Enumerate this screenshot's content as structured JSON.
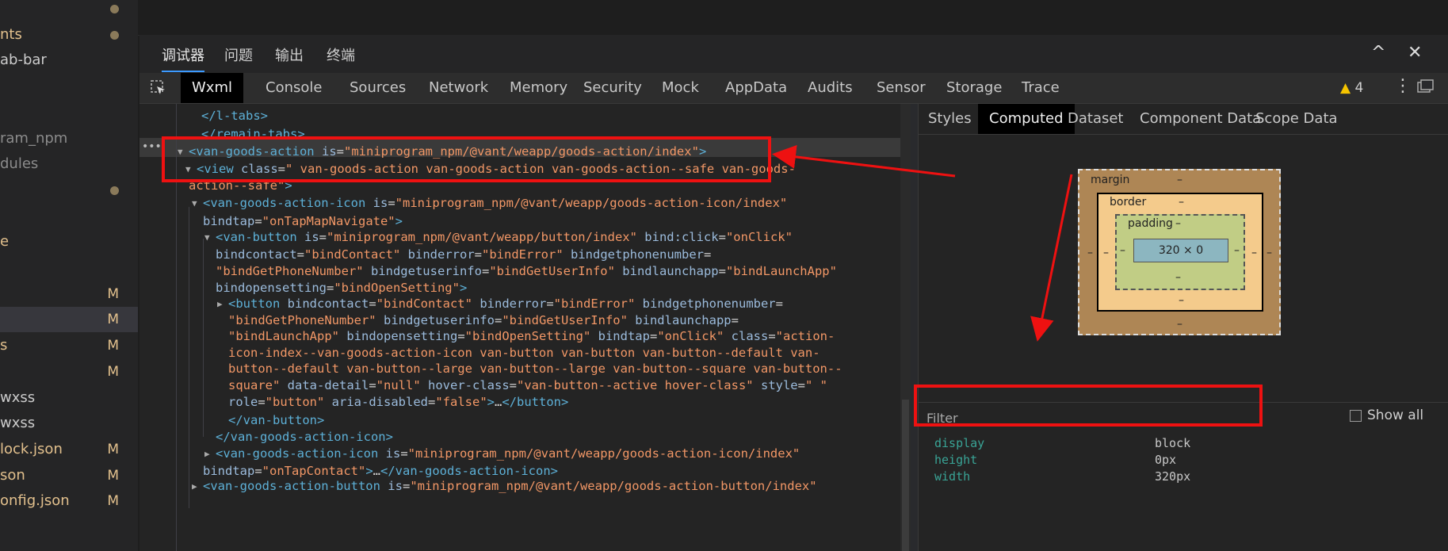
{
  "explorer": {
    "items": [
      {
        "label": "",
        "mark": "dot",
        "color": "g"
      },
      {
        "label": "nts",
        "mark": "dot",
        "color": "y"
      },
      {
        "label": "ab-bar",
        "mark": "",
        "color": "g"
      },
      {
        "label": "",
        "mark": "",
        "color": "g"
      },
      {
        "label": "",
        "mark": "",
        "color": "g"
      },
      {
        "label": "ram_npm",
        "mark": "",
        "color": "d"
      },
      {
        "label": "dules",
        "mark": "",
        "color": "d"
      },
      {
        "label": "",
        "mark": "dot",
        "color": "g"
      },
      {
        "label": "",
        "mark": "",
        "color": "g"
      },
      {
        "label": "e",
        "mark": "",
        "color": "y"
      },
      {
        "label": "",
        "mark": "",
        "color": "g"
      },
      {
        "label": "",
        "mark": "M",
        "color": "y"
      },
      {
        "label": "",
        "mark": "M",
        "color": "y"
      },
      {
        "label": "s",
        "mark": "M",
        "color": "y"
      },
      {
        "label": "",
        "mark": "M",
        "color": "y"
      },
      {
        "label": "wxss",
        "mark": "",
        "color": "g"
      },
      {
        "label": "wxss",
        "mark": "",
        "color": "g"
      },
      {
        "label": "lock.json",
        "mark": "M",
        "color": "y"
      },
      {
        "label": "son",
        "mark": "M",
        "color": "y"
      },
      {
        "label": "onfig.json",
        "mark": "M",
        "color": "y"
      }
    ]
  },
  "panel_tabs": [
    "调试器",
    "问题",
    "输出",
    "终端"
  ],
  "window_controls": {
    "collapse": "^",
    "close": "✕"
  },
  "tool_tabs": [
    "Wxml",
    "Console",
    "Sources",
    "Network",
    "Memory",
    "Security",
    "Mock",
    "AppData",
    "Audits",
    "Sensor",
    "Storage",
    "Trace"
  ],
  "warnings": {
    "count": "4",
    "icon": "warning-triangle-icon"
  },
  "tree": {
    "lines": [
      [
        [
          "tg",
          "</l-tabs>"
        ]
      ],
      [
        [
          "tg",
          "</remain-tabs>"
        ]
      ],
      [
        [
          "tg",
          "<van-goods-action "
        ],
        [
          "an",
          "is"
        ],
        [
          "tx",
          "="
        ],
        [
          "av",
          "\"miniprogram_npm/@vant/weapp/goods-action/index\""
        ],
        [
          "tg",
          ">"
        ]
      ],
      [
        [
          "tg",
          "<view "
        ],
        [
          "an",
          "class"
        ],
        [
          "tx",
          "="
        ],
        [
          "av",
          "\" van-goods-action van-goods-action van-goods-action--safe van-goods-"
        ]
      ],
      [
        [
          "av",
          "action--safe\""
        ],
        [
          "tg",
          ">"
        ]
      ],
      [
        [
          "tg",
          "<van-goods-action-icon "
        ],
        [
          "an",
          "is"
        ],
        [
          "tx",
          "="
        ],
        [
          "av",
          "\"miniprogram_npm/@vant/weapp/goods-action-icon/index\""
        ]
      ],
      [
        [
          "an",
          "bindtap"
        ],
        [
          "tx",
          "="
        ],
        [
          "av",
          "\"onTapMapNavigate\""
        ],
        [
          "tg",
          ">"
        ]
      ],
      [
        [
          "tg",
          "<van-button "
        ],
        [
          "an",
          "is"
        ],
        [
          "tx",
          "="
        ],
        [
          "av",
          "\"miniprogram_npm/@vant/weapp/button/index\""
        ],
        [
          "tx",
          " "
        ],
        [
          "an",
          "bind:click"
        ],
        [
          "tx",
          "="
        ],
        [
          "av",
          "\"onClick\""
        ]
      ],
      [
        [
          "an",
          "bindcontact"
        ],
        [
          "tx",
          "="
        ],
        [
          "av",
          "\"bindContact\""
        ],
        [
          "tx",
          " "
        ],
        [
          "an",
          "binderror"
        ],
        [
          "tx",
          "="
        ],
        [
          "av",
          "\"bindError\""
        ],
        [
          "tx",
          " "
        ],
        [
          "an",
          "bindgetphonenumber"
        ],
        [
          "tx",
          "="
        ]
      ],
      [
        [
          "av",
          "\"bindGetPhoneNumber\""
        ],
        [
          "tx",
          " "
        ],
        [
          "an",
          "bindgetuserinfo"
        ],
        [
          "tx",
          "="
        ],
        [
          "av",
          "\"bindGetUserInfo\""
        ],
        [
          "tx",
          " "
        ],
        [
          "an",
          "bindlaunchapp"
        ],
        [
          "tx",
          "="
        ],
        [
          "av",
          "\"bindLaunchApp\""
        ]
      ],
      [
        [
          "an",
          "bindopensetting"
        ],
        [
          "tx",
          "="
        ],
        [
          "av",
          "\"bindOpenSetting\""
        ],
        [
          "tg",
          ">"
        ]
      ],
      [
        [
          "tg",
          "<button "
        ],
        [
          "an",
          "bindcontact"
        ],
        [
          "tx",
          "="
        ],
        [
          "av",
          "\"bindContact\""
        ],
        [
          "tx",
          " "
        ],
        [
          "an",
          "binderror"
        ],
        [
          "tx",
          "="
        ],
        [
          "av",
          "\"bindError\""
        ],
        [
          "tx",
          " "
        ],
        [
          "an",
          "bindgetphonenumber"
        ],
        [
          "tx",
          "="
        ]
      ],
      [
        [
          "av",
          "\"bindGetPhoneNumber\""
        ],
        [
          "tx",
          " "
        ],
        [
          "an",
          "bindgetuserinfo"
        ],
        [
          "tx",
          "="
        ],
        [
          "av",
          "\"bindGetUserInfo\""
        ],
        [
          "tx",
          " "
        ],
        [
          "an",
          "bindlaunchapp"
        ],
        [
          "tx",
          "="
        ]
      ],
      [
        [
          "av",
          "\"bindLaunchApp\""
        ],
        [
          "tx",
          " "
        ],
        [
          "an",
          "bindopensetting"
        ],
        [
          "tx",
          "="
        ],
        [
          "av",
          "\"bindOpenSetting\""
        ],
        [
          "tx",
          " "
        ],
        [
          "an",
          "bindtap"
        ],
        [
          "tx",
          "="
        ],
        [
          "av",
          "\"onClick\""
        ],
        [
          "tx",
          " "
        ],
        [
          "an",
          "class"
        ],
        [
          "tx",
          "="
        ],
        [
          "av",
          "\"action-"
        ]
      ],
      [
        [
          "av",
          "icon-index--van-goods-action-icon van-button van-button van-button--default van-"
        ]
      ],
      [
        [
          "av",
          "button--default van-button--large van-button--large van-button--square van-button--"
        ]
      ],
      [
        [
          "av",
          "square\""
        ],
        [
          "tx",
          " "
        ],
        [
          "an",
          "data-detail"
        ],
        [
          "tx",
          "="
        ],
        [
          "av",
          "\"null\""
        ],
        [
          "tx",
          " "
        ],
        [
          "an",
          "hover-class"
        ],
        [
          "tx",
          "="
        ],
        [
          "av",
          "\"van-button--active hover-class\""
        ],
        [
          "tx",
          " "
        ],
        [
          "an",
          "style"
        ],
        [
          "tx",
          "="
        ],
        [
          "av",
          "\" \""
        ]
      ],
      [
        [
          "an",
          "role"
        ],
        [
          "tx",
          "="
        ],
        [
          "av",
          "\"button\""
        ],
        [
          "tx",
          " "
        ],
        [
          "an",
          "aria-disabled"
        ],
        [
          "tx",
          "="
        ],
        [
          "av",
          "\"false\""
        ],
        [
          "tg",
          ">"
        ],
        [
          "tx",
          "…"
        ],
        [
          "tg",
          "</button>"
        ]
      ],
      [
        [
          "tg",
          "</van-button>"
        ]
      ],
      [
        [
          "tg",
          "</van-goods-action-icon>"
        ]
      ],
      [
        [
          "tg",
          "<van-goods-action-icon "
        ],
        [
          "an",
          "is"
        ],
        [
          "tx",
          "="
        ],
        [
          "av",
          "\"miniprogram_npm/@vant/weapp/goods-action-icon/index\""
        ]
      ],
      [
        [
          "an",
          "bindtap"
        ],
        [
          "tx",
          "="
        ],
        [
          "av",
          "\"onTapContact\""
        ],
        [
          "tg",
          ">"
        ],
        [
          "tx",
          "…"
        ],
        [
          "tg",
          "</van-goods-action-icon>"
        ]
      ],
      [
        [
          "tg",
          "<van-goods-action-button "
        ],
        [
          "an",
          "is"
        ],
        [
          "tx",
          "="
        ],
        [
          "av",
          "\"miniprogram_npm/@vant/weapp/goods-action-button/index\""
        ]
      ]
    ]
  },
  "side_tabs": [
    "Styles",
    "Computed",
    "Dataset",
    "Component Data",
    "Scope Data"
  ],
  "box_model": {
    "margin_label": "margin",
    "border_label": "border",
    "padding_label": "padding",
    "content": "320 × 0",
    "dash": "–"
  },
  "filter": {
    "label": "Filter",
    "show_all": "Show all"
  },
  "computed": [
    {
      "name": "display",
      "value": "block"
    },
    {
      "name": "height",
      "value": "0px"
    },
    {
      "name": "width",
      "value": "320px"
    }
  ]
}
